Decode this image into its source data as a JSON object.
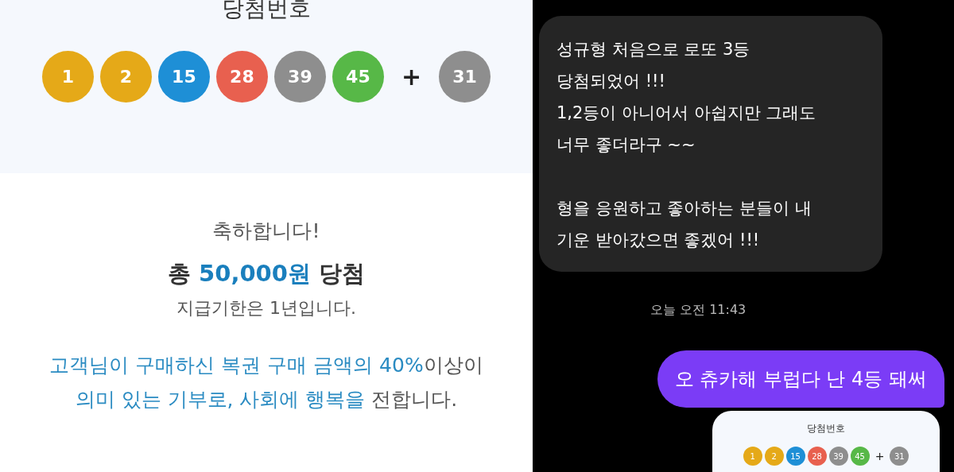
{
  "result_panel": {
    "title": "당첨번호",
    "balls": [
      {
        "number": "1",
        "color": "#e5a918"
      },
      {
        "number": "2",
        "color": "#e5a918"
      },
      {
        "number": "15",
        "color": "#1e8fd6"
      },
      {
        "number": "28",
        "color": "#e8604f"
      },
      {
        "number": "39",
        "color": "#8e8e8e"
      },
      {
        "number": "45",
        "color": "#57b847"
      }
    ],
    "plus": "+",
    "bonus_ball": {
      "number": "31",
      "color": "#8e8e8e"
    },
    "congrats": "축하합니다!",
    "prize_parts": [
      {
        "text": "총 ",
        "highlighted": false
      },
      {
        "text": "50,000원",
        "highlighted": true
      },
      {
        "text": " 당첨",
        "highlighted": false
      }
    ],
    "deadline": "지급기한은 1년입니다.",
    "donation_lines": [
      [
        {
          "text": "고객님이 구매하신 복권 구매 금액의 40%",
          "highlighted": true
        },
        {
          "text": "이상이",
          "highlighted": false
        }
      ],
      [
        {
          "text": "의미 있는 기부로, 사회에 행복을",
          "highlighted": true
        },
        {
          "text": " 전합니다.",
          "highlighted": false
        }
      ]
    ]
  },
  "chat": {
    "messages": [
      {
        "kind": "received",
        "text": "성규형 처음으로 로또 3등\n당첨되었어 !!!\n1,2등이 아니어서 아쉽지만 그래도\n너무 좋더라구 ~~\n\n형을 응원하고 좋아하는 분들이 내\n기운 받아갔으면 좋겠어 !!!"
      },
      {
        "kind": "timestamp",
        "text": "오늘 오전 11:43"
      },
      {
        "kind": "sent",
        "text": "오 츄카해 부럽다 난 4등 돼써"
      },
      {
        "kind": "image",
        "title": "당첨번호",
        "balls": [
          {
            "number": "1",
            "color": "#e5a918"
          },
          {
            "number": "2",
            "color": "#e5a918"
          },
          {
            "number": "15",
            "color": "#1e8fd6"
          },
          {
            "number": "28",
            "color": "#e8604f"
          },
          {
            "number": "39",
            "color": "#8e8e8e"
          },
          {
            "number": "45",
            "color": "#57b847"
          }
        ],
        "plus": "+",
        "bonus_ball": {
          "number": "31",
          "color": "#8e8e8e"
        }
      }
    ]
  }
}
